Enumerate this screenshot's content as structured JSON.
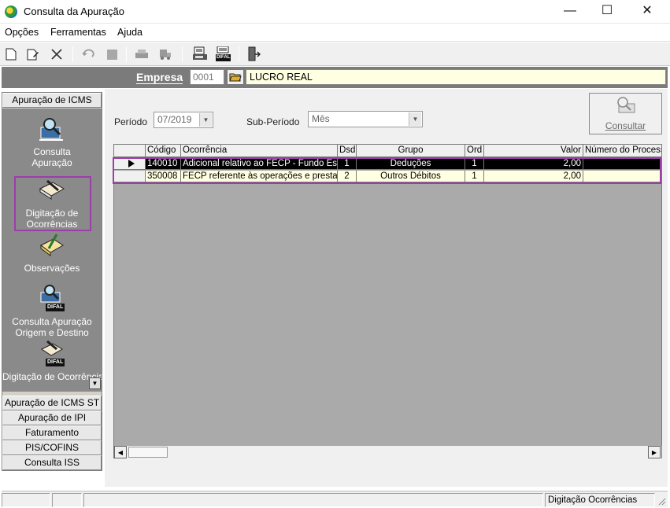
{
  "window": {
    "title": "Consulta da Apuração",
    "minimize": "—",
    "maximize": "☐",
    "close": "✕"
  },
  "menu": [
    "Opções",
    "Ferramentas",
    "Ajuda"
  ],
  "toolbar": {
    "difal_badge": "DIFAL"
  },
  "empresa": {
    "label": "Empresa",
    "code": "0001",
    "name": "LUCRO REAL"
  },
  "sidebar": {
    "active_section": "Apuração de ICMS",
    "items": [
      {
        "label": "Consulta Apuração"
      },
      {
        "label": "Digitação de Ocorrências"
      },
      {
        "label": "Observações"
      },
      {
        "label": "Consulta Apuração Origem e Destino",
        "badge": "DIFAL"
      },
      {
        "label": "Digitação de Ocorrências Orig. De",
        "badge": "DIFAL"
      }
    ],
    "sections": [
      "Apuração de ICMS ST",
      "Apuração de IPI",
      "Faturamento",
      "PIS/COFINS",
      "Consulta ISS"
    ]
  },
  "filters": {
    "periodo_label": "Período",
    "periodo_value": "07/2019",
    "subperiodo_label": "Sub-Período",
    "subperiodo_value": "Mês",
    "consultar_label": "Consultar"
  },
  "grid": {
    "columns": [
      "Código",
      "Ocorrência",
      "Dsd",
      "Grupo",
      "Ord",
      "Valor",
      "Número do Process"
    ],
    "rows": [
      {
        "codigo": "140010",
        "ocorrencia": "Adicional relativo ao FECP - Fundo Est",
        "dsd": "1",
        "grupo": "Deduções",
        "ord": "1",
        "valor": "2,00",
        "processo": ""
      },
      {
        "codigo": "350008",
        "ocorrencia": "FECP referente às operações e presta",
        "dsd": "2",
        "grupo": "Outros Débitos",
        "ord": "1",
        "valor": "2,00",
        "processo": ""
      }
    ]
  },
  "status": {
    "text": "Digitação Ocorrências"
  },
  "colors": {
    "accent_highlight": "#9b3fa8",
    "empresa_bar": "#7b7b7b",
    "selected_row": "#000000",
    "row_bg": "#ffffe1"
  }
}
